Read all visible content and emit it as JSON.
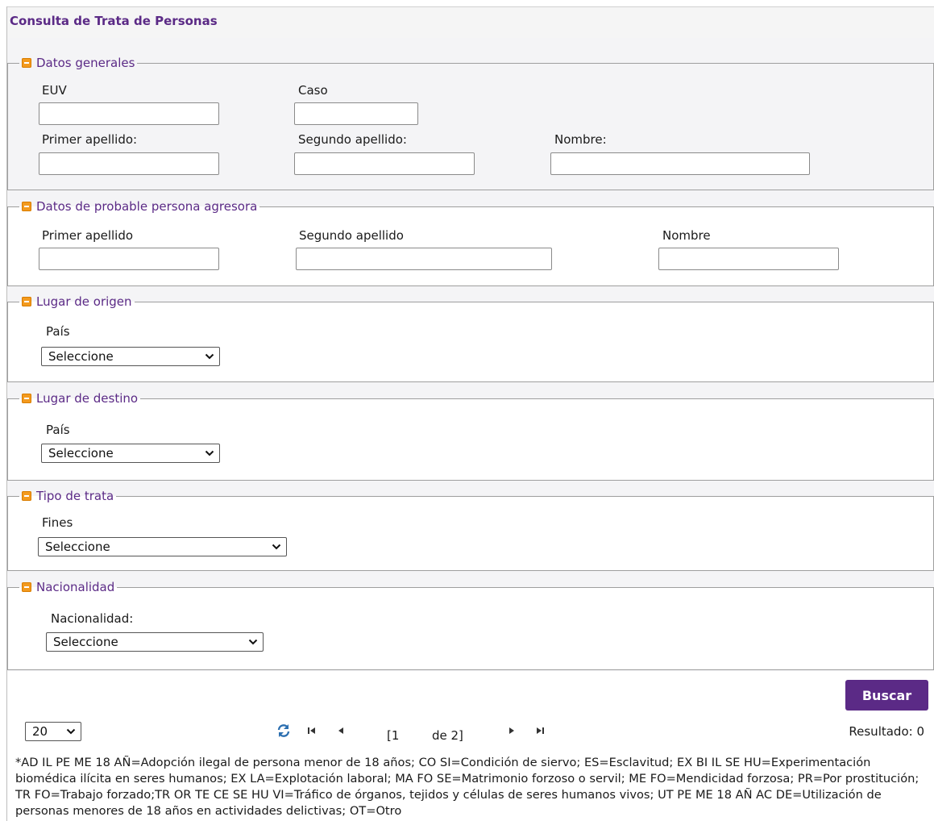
{
  "title": "Consulta de Trata de Personas",
  "sections": {
    "datos_generales": {
      "legend": "Datos generales",
      "euv_label": "EUV",
      "caso_label": "Caso",
      "primer_apellido_label": "Primer apellido:",
      "segundo_apellido_label": "Segundo apellido:",
      "nombre_label": "Nombre:"
    },
    "agresora": {
      "legend": "Datos de probable persona agresora",
      "primer_apellido_label": "Primer apellido",
      "segundo_apellido_label": "Segundo apellido",
      "nombre_label": "Nombre"
    },
    "origen": {
      "legend": "Lugar de origen",
      "pais_label": "País",
      "pais_value": "Seleccione"
    },
    "destino": {
      "legend": "Lugar de destino",
      "pais_label": "País",
      "pais_value": "Seleccione"
    },
    "tipo_trata": {
      "legend": "Tipo de trata",
      "fines_label": "Fines",
      "fines_value": "Seleccione"
    },
    "nacionalidad": {
      "legend": "Nacionalidad",
      "nacionalidad_label": "Nacionalidad:",
      "nacionalidad_value": "Seleccione"
    }
  },
  "buscar_label": "Buscar",
  "pager": {
    "page_size": "20",
    "page_open": "[1",
    "page_total": "de 2]",
    "result": "Resultado: 0"
  },
  "footnote": "*AD IL PE ME 18 AÑ=Adopción ilegal de persona menor de 18 años; CO SI=Condición de siervo; ES=Esclavitud; EX BI IL SE HU=Experimentación biomédica ilícita en seres humanos; EX LA=Explotación laboral; MA FO SE=Matrimonio forzoso o servil; ME FO=Mendicidad forzosa; PR=Por prostitución; TR FO=Trabajo forzado;TR OR TE CE SE HU VI=Tráfico de órganos, tejidos y células de seres humanos vivos; UT PE ME 18 AÑ AC DE=Utilización de personas menores de 18 años en actividades delictivas; OT=Otro",
  "colors": {
    "accent": "#5b2a86",
    "icon_orange": "#f39a1e"
  }
}
